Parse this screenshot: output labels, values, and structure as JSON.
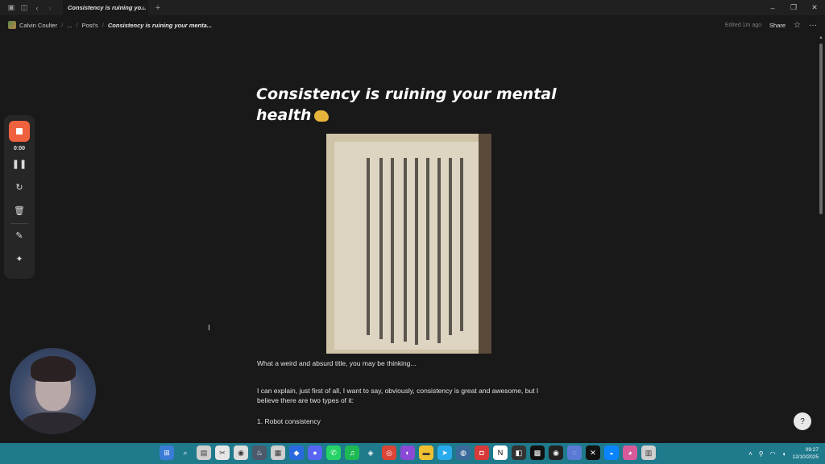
{
  "titlebar": {
    "tab_title": "Consistency is ruining yo...",
    "tab_close": "×",
    "new_tab": "+",
    "minimize": "–",
    "restore": "❐",
    "close": "✕"
  },
  "breadcrumb": {
    "workspace": "Calvin Coulter",
    "ellipsis": "...",
    "parent": "Post's",
    "current": "Consistency is ruining your menta..."
  },
  "topbar": {
    "edited": "Edited 1m ago",
    "share": "Share"
  },
  "page": {
    "title": "Consistency is ruining your mental health",
    "para1": "What a weird and absurd title, you may be thinking...",
    "para2": "I can explain, just first of all, I want to say, obviously, consistency is great and awesome, but I believe there are two types of it:",
    "list1": "1. Robot consistency"
  },
  "recorder": {
    "time": "0:00"
  },
  "taskbar": {
    "time": "09:27",
    "date": "12/10/2025"
  },
  "icons": {
    "app": "notion-icon",
    "sidebar": "sidebar-toggle-icon",
    "back": "back-arrow-icon",
    "forward": "forward-arrow-icon",
    "star": "star-icon",
    "more": "more-icon"
  },
  "colors": {
    "accent_record": "#f0623d",
    "taskbar": "#1f7a8c",
    "background": "#191919"
  }
}
